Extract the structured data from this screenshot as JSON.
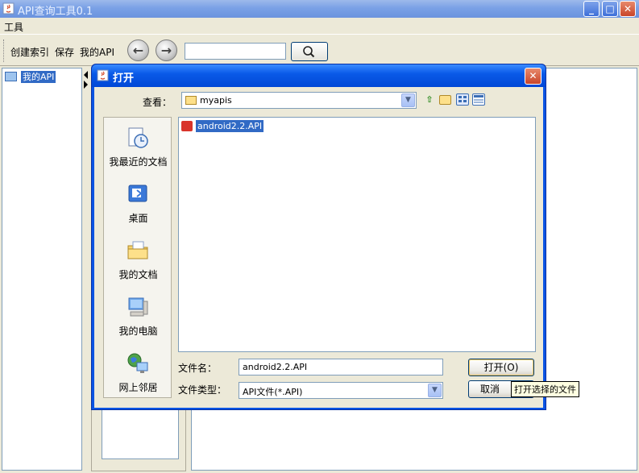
{
  "window": {
    "title": "API查询工具0.1",
    "minimize": "_",
    "maximize": "□",
    "close": "✕"
  },
  "menu": {
    "items": [
      {
        "label": "工具"
      }
    ]
  },
  "toolbar": {
    "create_index": "创建索引",
    "save": "保存",
    "my_api": "我的API",
    "back_icon": "arrow-left-icon",
    "forward_icon": "arrow-right-icon",
    "back_glyph": "←",
    "forward_glyph": "→",
    "search_value": "",
    "search_icon": "magnifier-icon"
  },
  "tree": {
    "root": "我的API"
  },
  "dialog": {
    "title": "打开",
    "look_in_label": "查看：",
    "look_in_value": "myapis",
    "places": [
      {
        "label": "我最近的文档",
        "icon": "recent-documents-icon"
      },
      {
        "label": "桌面",
        "icon": "desktop-icon"
      },
      {
        "label": "我的文档",
        "icon": "my-documents-icon"
      },
      {
        "label": "我的电脑",
        "icon": "my-computer-icon"
      },
      {
        "label": "网上邻居",
        "icon": "network-places-icon"
      }
    ],
    "files": [
      {
        "name": "android2.2.API",
        "selected": true
      }
    ],
    "filename_label": "文件名：",
    "filename_value": "android2.2.API",
    "filetype_label": "文件类型：",
    "filetype_value": "API文件(*.API)",
    "open_button": "打开(O)",
    "cancel_button": "取消",
    "tooltip": "打开选择的文件"
  },
  "colors": {
    "title_bar": "#7aa1e6",
    "dialog_title": "#0a5ae8",
    "selection": "#316ac5",
    "face": "#ece9d8"
  }
}
